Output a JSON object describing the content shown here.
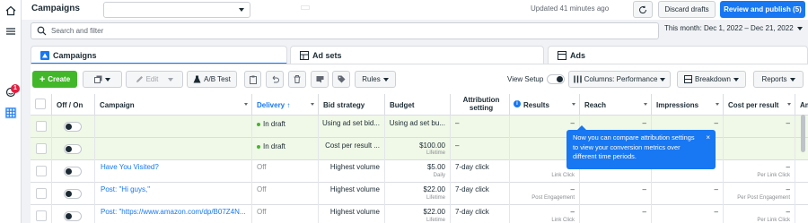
{
  "topbar": {
    "title": "Campaigns",
    "updated": "Updated 41 minutes ago",
    "discard": "Discard drafts",
    "publish": "Review and publish (5)",
    "more": "···"
  },
  "search": {
    "placeholder": "Search and filter"
  },
  "date_range": "This month: Dec 1, 2022 – Dec 21, 2022",
  "tabs": [
    {
      "label": "Campaigns"
    },
    {
      "label": "Ad sets"
    },
    {
      "label": "Ads"
    }
  ],
  "toolbar": {
    "create": "Create",
    "edit": "Edit",
    "ab_test": "A/B Test",
    "rules": "Rules",
    "view_setup": "View Setup",
    "columns": "Columns: Performance",
    "breakdown": "Breakdown",
    "reports": "Reports"
  },
  "columns": [
    "Off / On",
    "Campaign",
    "Delivery ↑",
    "Bid strategy",
    "Budget",
    "Attribution setting",
    "Results",
    "Reach",
    "Impressions",
    "Cost per result",
    "Am"
  ],
  "rows": [
    {
      "campaign": "",
      "delivery": "In draft",
      "bid": "Using ad set bid...",
      "budget": "Using ad set bu...",
      "budget_sub": "",
      "attribution": "–",
      "results": "–",
      "results_sub": "",
      "reach": "–",
      "impressions": "–",
      "cost": "–",
      "cost_sub": ""
    },
    {
      "campaign": "",
      "delivery": "In draft",
      "bid": "Cost per result ...",
      "budget": "$100.00",
      "budget_sub": "Lifetime",
      "attribution": "–",
      "results": "",
      "results_sub": "",
      "reach": "",
      "impressions": "",
      "cost": "",
      "cost_sub": ""
    },
    {
      "campaign": "Have You Visited?",
      "delivery": "Off",
      "bid": "Highest volume",
      "budget": "$5.00",
      "budget_sub": "Daily",
      "attribution": "7-day click",
      "results": "",
      "results_sub": "Link Click",
      "reach": "",
      "impressions": "",
      "cost": "–",
      "cost_sub": "Per Link Click"
    },
    {
      "campaign": "Post: \"Hi guys,\"",
      "delivery": "Off",
      "bid": "Highest volume",
      "budget": "$22.00",
      "budget_sub": "Lifetime",
      "attribution": "7-day click",
      "results": "–",
      "results_sub": "Post Engagement",
      "reach": "–",
      "impressions": "–",
      "cost": "–",
      "cost_sub": "Per Post Engagement"
    },
    {
      "campaign": "Post: \"https://www.amazon.com/dp/B07Z4N...",
      "delivery": "Off",
      "bid": "Highest volume",
      "budget": "$22.00",
      "budget_sub": "Lifetime",
      "attribution": "7-day click",
      "results": "–",
      "results_sub": "Link Click",
      "reach": "–",
      "impressions": "–",
      "cost": "–",
      "cost_sub": "Per Link Click"
    }
  ],
  "tooltip": {
    "text": "Now you can compare attribution settings to view your conversion metrics over different time periods.",
    "close": "×"
  },
  "rail": {
    "badge": "1"
  }
}
